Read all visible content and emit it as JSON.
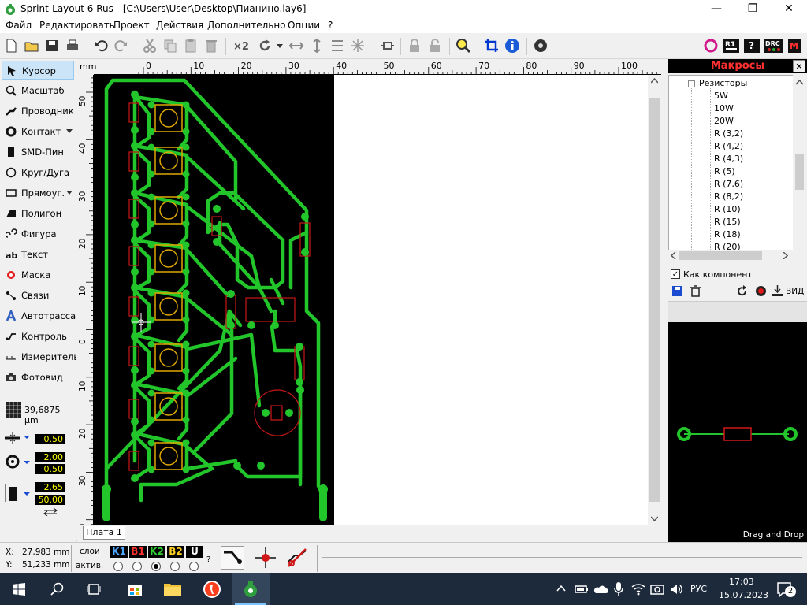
{
  "window": {
    "title": "Sprint-Layout 6 Rus - [C:\\Users\\User\\Desktop\\Пианино.lay6]",
    "controls": {
      "minimize": "—",
      "maximize": "❐",
      "close": "✕"
    }
  },
  "menu": [
    "Файл",
    "Редактировать",
    "Проект",
    "Действия",
    "Дополнительно",
    "Опции",
    "?"
  ],
  "tools": [
    {
      "label": "Курсор",
      "icon": "cursor-icon",
      "active": true
    },
    {
      "label": "Масштаб",
      "icon": "zoom-icon"
    },
    {
      "label": "Проводник",
      "icon": "track-icon"
    },
    {
      "label": "Контакт",
      "icon": "pad-icon"
    },
    {
      "label": "SMD-Пин",
      "icon": "smd-pad-icon"
    },
    {
      "label": "Круг/Дуга",
      "icon": "circle-icon"
    },
    {
      "label": "Прямоуг.",
      "icon": "rectangle-icon"
    },
    {
      "label": "Полигон",
      "icon": "polygon-icon"
    },
    {
      "label": "Фигура",
      "icon": "shape-icon"
    },
    {
      "label": "Текст",
      "icon": "text-icon"
    },
    {
      "label": "Маска",
      "icon": "mask-icon"
    },
    {
      "label": "Связи",
      "icon": "connections-icon"
    },
    {
      "label": "Автотрасса",
      "icon": "autoroute-icon"
    },
    {
      "label": "Контроль",
      "icon": "check-icon"
    },
    {
      "label": "Измеритель",
      "icon": "measure-icon"
    },
    {
      "label": "Фотовид",
      "icon": "photoview-icon"
    }
  ],
  "grid": {
    "value": "39,6875 µm"
  },
  "params": {
    "track_width": "0.50",
    "pad_outer": "2.00",
    "pad_inner": "0.50",
    "smd_w": "2.65",
    "smd_h": "50.00"
  },
  "ruler": {
    "unit": "mm",
    "top": [
      "0",
      "10",
      "20",
      "30",
      "40",
      "50",
      "60",
      "70",
      "80",
      "90",
      "100"
    ],
    "left": [
      "50",
      "40",
      "30",
      "20",
      "10",
      "0",
      "10",
      "20",
      "30",
      "40"
    ]
  },
  "board_tab": "Плата 1",
  "macros": {
    "title": "Макросы",
    "close": "✕",
    "tree_group": "Резисторы",
    "tree_items": [
      "5W",
      "10W",
      "20W",
      "R (3,2)",
      "R (4,2)",
      "R (4,3)",
      "R (5)",
      "R (7,6)",
      "R (8,2)",
      "R (10)",
      "R (15)",
      "R (18)",
      "R (20)"
    ],
    "as_component": "Как компонент",
    "view_label": "ВИД",
    "drag_hint": "Drag and Drop"
  },
  "status": {
    "x_label": "X:",
    "x_value": "27,983 mm",
    "y_label": "Y:",
    "y_value": "51,233 mm",
    "layers_label": "слои",
    "active_label": "актив.",
    "layers": [
      {
        "name": "K1",
        "color": "#4da6ff"
      },
      {
        "name": "B1",
        "color": "#ff3030"
      },
      {
        "name": "K2",
        "color": "#30d030"
      },
      {
        "name": "B2",
        "color": "#ffd020"
      },
      {
        "name": "U",
        "color": "#ffffff"
      }
    ],
    "help": "?"
  },
  "taskbar": {
    "lang": "РУС",
    "time": "17:03",
    "date": "15.07.2023",
    "notifications": "2"
  }
}
